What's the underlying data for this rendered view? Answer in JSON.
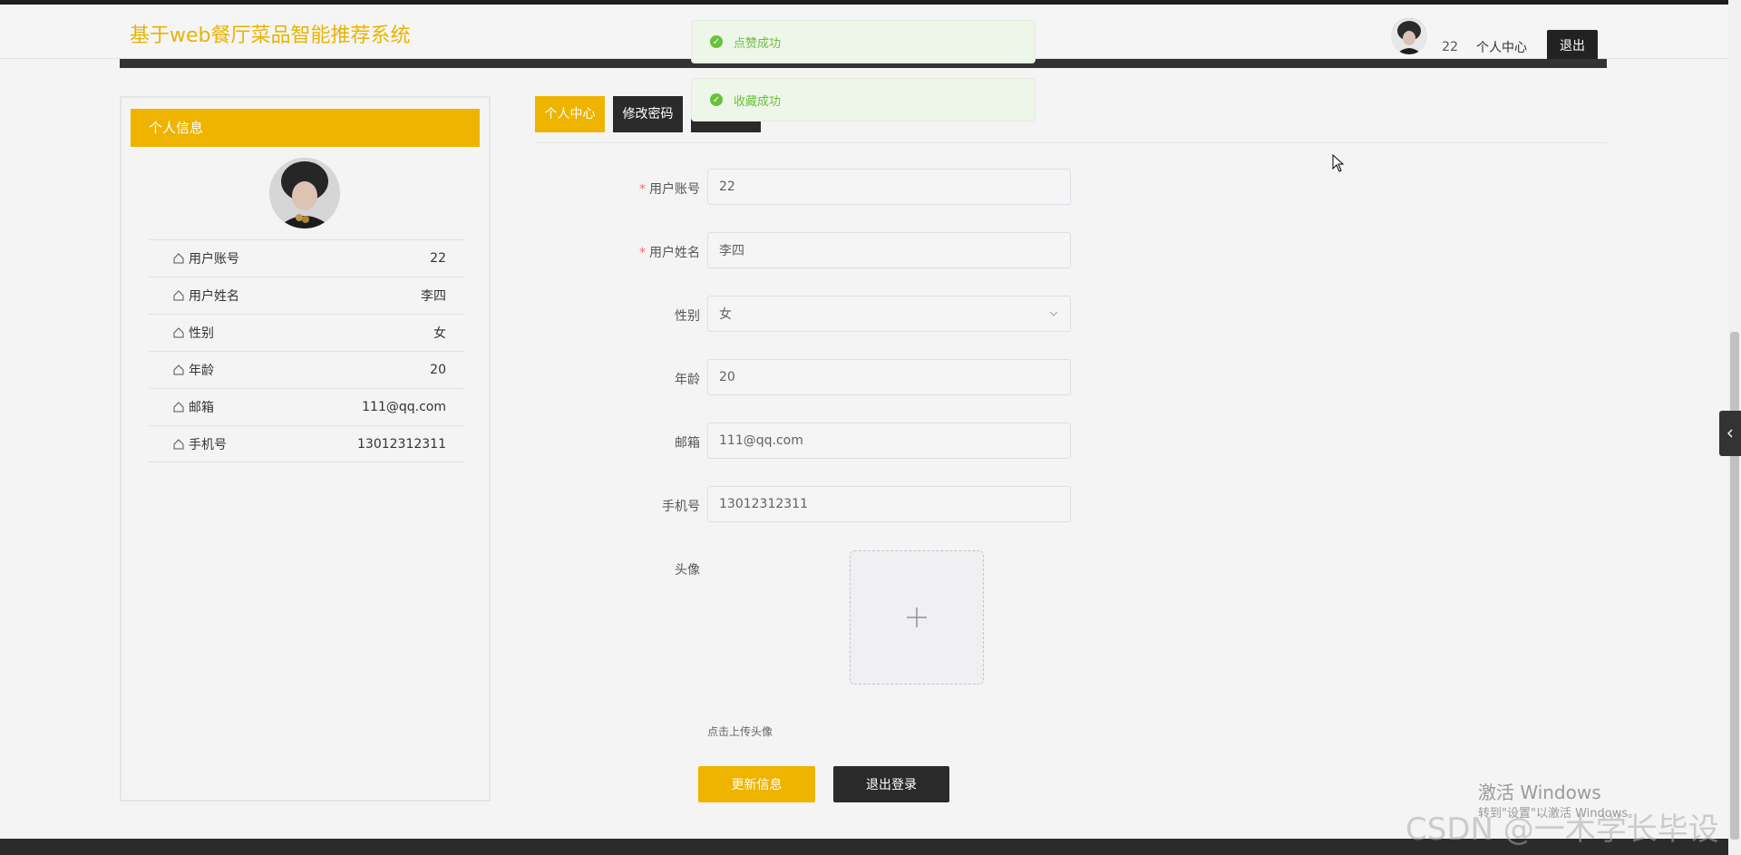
{
  "header": {
    "site_title": "基于web餐厅菜品智能推荐系统",
    "user_id": "22",
    "personal_center": "个人中心",
    "logout": "退出"
  },
  "toasts": [
    {
      "text": "点赞成功"
    },
    {
      "text": "收藏成功"
    }
  ],
  "left_panel": {
    "title": "个人信息",
    "rows": [
      {
        "label": "用户账号",
        "value": "22"
      },
      {
        "label": "用户姓名",
        "value": "李四"
      },
      {
        "label": "性别",
        "value": "女"
      },
      {
        "label": "年龄",
        "value": "20"
      },
      {
        "label": "邮箱",
        "value": "111@qq.com"
      },
      {
        "label": "手机号",
        "value": "13012312311"
      }
    ]
  },
  "tabs": [
    {
      "label": "个人中心"
    },
    {
      "label": "修改密码"
    },
    {
      "label": ""
    }
  ],
  "form": {
    "account_label": "用户账号",
    "account_value": "22",
    "name_label": "用户姓名",
    "name_value": "李四",
    "gender_label": "性别",
    "gender_value": "女",
    "age_label": "年龄",
    "age_value": "20",
    "email_label": "邮箱",
    "email_value": "111@qq.com",
    "phone_label": "手机号",
    "phone_value": "13012312311",
    "avatar_label": "头像",
    "upload_hint": "点击上传头像",
    "update_button": "更新信息",
    "logout_button": "退出登录"
  },
  "watermark": {
    "line1": "激活 Windows",
    "line2": "转到\"设置\"以激活 Windows。",
    "csdn": "CSDN @一木学长毕设"
  },
  "colors": {
    "accent": "#eeb400",
    "dark": "#2a2a2a",
    "success": "#67c23a"
  }
}
